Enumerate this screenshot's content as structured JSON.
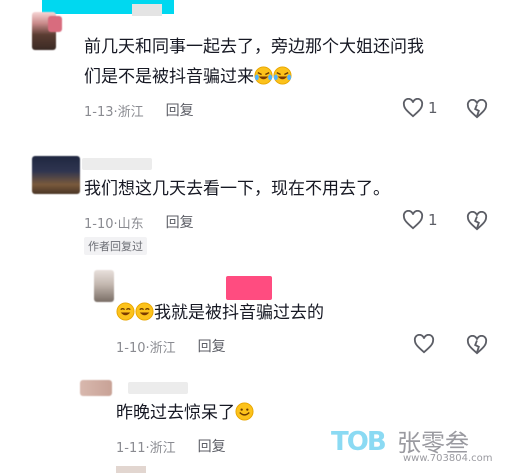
{
  "comments": [
    {
      "text_line1": "前几天和同事一起去了，旁边那个大姐还问我",
      "text_line2": "们是不是被抖音骗过来",
      "date": "1-13",
      "location": "浙江",
      "reply": "回复",
      "likes": "1"
    },
    {
      "text": "我们想这几天去看一下，现在不用去了。",
      "date": "1-10",
      "location": "山东",
      "reply": "回复",
      "likes": "1",
      "tag": "作者回复过"
    },
    {
      "text": "我就是被抖音骗过去的",
      "date": "1-10",
      "location": "浙江",
      "reply": "回复"
    },
    {
      "text": "昨晚过去惊呆了",
      "date": "1-11",
      "location": "浙江",
      "reply": "回复"
    }
  ],
  "watermark": {
    "logo": "TOB",
    "name": "张零叁",
    "url": "www.703804.com"
  },
  "colors": {
    "text": "#161823",
    "meta": "#8a8b91",
    "highlight_cyan": "#00d8f0",
    "highlight_pink": "#ff2d6a"
  },
  "icons": [
    "heart-outline-icon",
    "broken-heart-icon",
    "laughing-tears-emoji",
    "smile-emoji"
  ]
}
